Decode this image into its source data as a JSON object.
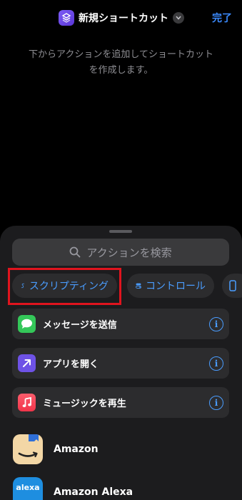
{
  "nav": {
    "title": "新規ショートカット",
    "done_label": "完了"
  },
  "hint": "下からアクションを追加してショートカットを作成します。",
  "search": {
    "placeholder": "アクションを検索"
  },
  "categories": [
    {
      "label": "スクリプティング",
      "icon": "scripting-icon",
      "selected": true
    },
    {
      "label": "コントロール",
      "icon": "toggle-icon"
    },
    {
      "label": "",
      "icon": "device-icon"
    }
  ],
  "actions": [
    {
      "label": "メッセージを送信",
      "icon": "messages-icon",
      "color": "#34c759"
    },
    {
      "label": "アプリを開く",
      "icon": "open-app-arrow-icon",
      "color": "#6e52e6"
    },
    {
      "label": "ミュージックを再生",
      "icon": "music-note-icon",
      "color": "#fa3c4c"
    }
  ],
  "apps": [
    {
      "name": "Amazon",
      "icon": "amazon-icon",
      "color": "#f3d7a6"
    },
    {
      "name": "Amazon Alexa",
      "icon": "alexa-icon",
      "icon_text": "alexa",
      "color": "#1e8ee0"
    }
  ],
  "colors": {
    "accent": "#4a9dff",
    "highlight": "#e0141e"
  }
}
